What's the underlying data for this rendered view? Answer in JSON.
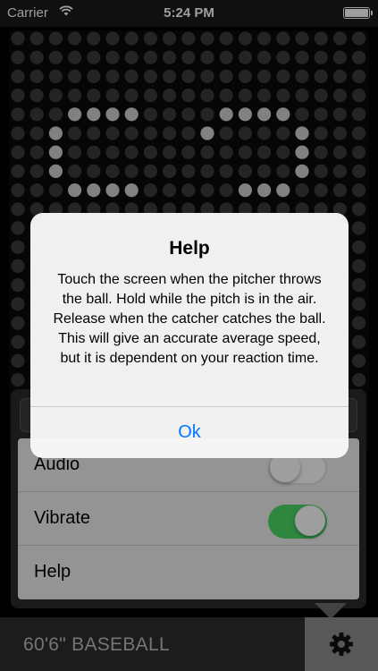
{
  "status_bar": {
    "carrier": "Carrier",
    "time": "5:24 PM",
    "icons": [
      "wifi-icon",
      "battery-icon"
    ]
  },
  "settings": {
    "rows": [
      {
        "label": "Audio",
        "toggle": "off"
      },
      {
        "label": "Vibrate",
        "toggle": "on"
      },
      {
        "label": "Help"
      }
    ]
  },
  "alert": {
    "title": "Help",
    "message": "Touch the screen when the pitcher throws the ball. Hold while the pitch is in the air. Release when the catcher catches the ball. This will give an accurate average speed, but it is dependent on your reaction time.",
    "ok_label": "Ok"
  },
  "bottom_bar": {
    "title": "60'6\" BASEBALL",
    "settings_icon": "gear-icon"
  },
  "colors": {
    "accent": "#007aff",
    "toggle_on": "#4cd964",
    "led_lit": "#d0d0d0",
    "led_unlit": "#3a3a3a"
  }
}
